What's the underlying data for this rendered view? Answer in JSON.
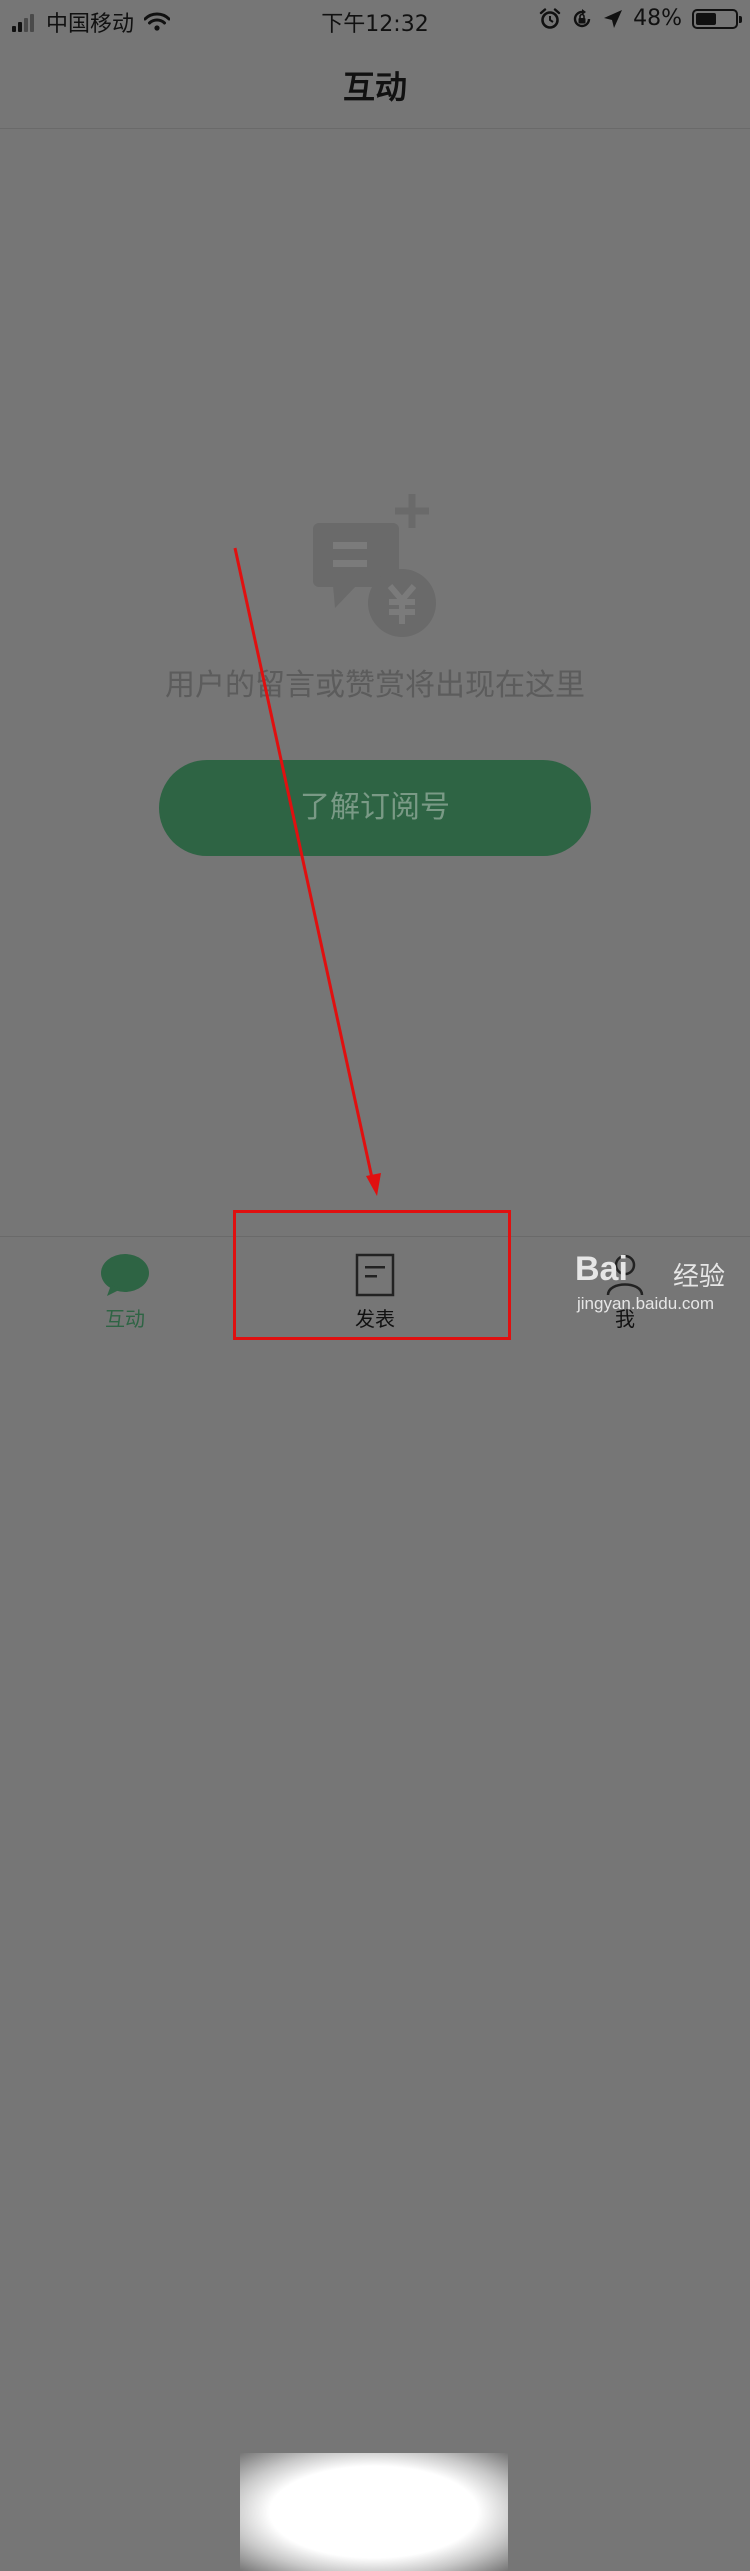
{
  "status_bar": {
    "carrier": "中国移动",
    "time": "下午12:32",
    "battery_percent": "48%",
    "battery_level": 0.48,
    "icons": [
      "signal-icon",
      "wifi-icon",
      "alarm-icon",
      "rotation-lock-icon",
      "location-arrow-icon",
      "battery-icon"
    ]
  },
  "nav": {
    "title": "互动"
  },
  "empty_state": {
    "icon": "comment-reward-icon",
    "message": "用户的留言或赞赏将出现在这里",
    "button_label": "了解订阅号"
  },
  "tabs": [
    {
      "label": "互动",
      "icon": "chat-bubble-icon",
      "active": true
    },
    {
      "label": "发表",
      "icon": "document-icon",
      "active": false
    },
    {
      "label": "我",
      "icon": "user-icon",
      "active": false
    }
  ],
  "watermark": {
    "logo": "Bai",
    "brand": "经验",
    "url": "jingyan.baidu.com"
  },
  "colors": {
    "accent": "#2e6444",
    "annotation": "#e01010",
    "overlay": "#767676"
  }
}
